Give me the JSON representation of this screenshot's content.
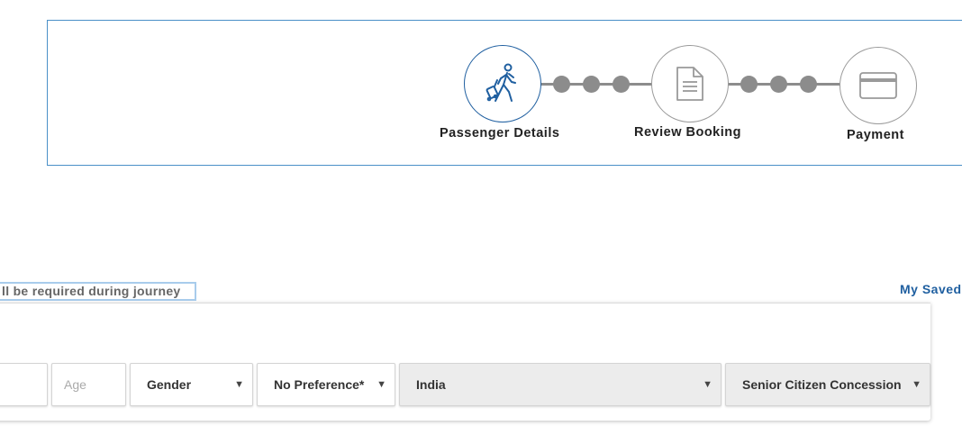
{
  "steps": [
    {
      "label": "Passenger Details",
      "icon": "traveler-icon",
      "state": "active"
    },
    {
      "label": "Review Booking",
      "icon": "document-icon",
      "state": "inactive"
    },
    {
      "label": "Payment",
      "icon": "credit-card-icon",
      "state": "inactive"
    }
  ],
  "colors": {
    "accent": "#1f5fa0",
    "border": "#4a90c8",
    "connector": "#8c8c8c"
  },
  "note": "ll be required during journey",
  "saved_link": "My Saved",
  "form": {
    "name_value": "",
    "age_placeholder": "Age",
    "gender_value": "Gender",
    "berth_value": "No Preference*",
    "nationality_value": "India",
    "concession_value": "Senior Citizen Concession"
  }
}
